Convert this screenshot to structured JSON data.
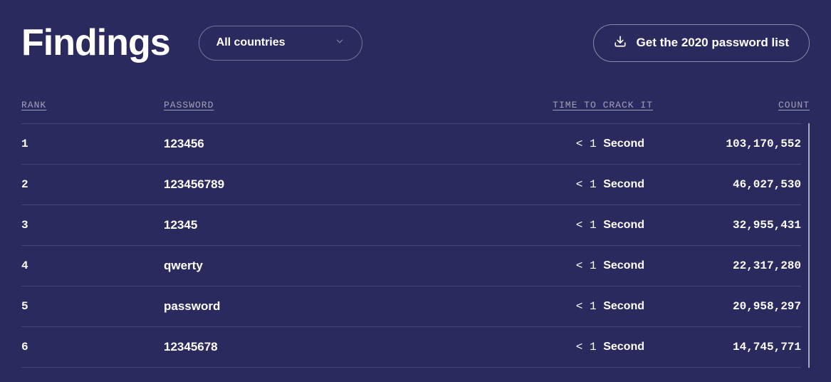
{
  "title": "Findings",
  "dropdown": {
    "selected": "All countries"
  },
  "download_button": "Get the 2020 password list",
  "table": {
    "headers": {
      "rank": "RANK",
      "password": "PASSWORD",
      "time": "TIME TO CRACK IT",
      "count": "COUNT"
    },
    "rows": [
      {
        "rank": "1",
        "password": "123456",
        "time_prefix": "< 1 ",
        "time_unit": "Second",
        "count": "103,170,552"
      },
      {
        "rank": "2",
        "password": "123456789",
        "time_prefix": "< 1 ",
        "time_unit": "Second",
        "count": "46,027,530"
      },
      {
        "rank": "3",
        "password": "12345",
        "time_prefix": "< 1 ",
        "time_unit": "Second",
        "count": "32,955,431"
      },
      {
        "rank": "4",
        "password": "qwerty",
        "time_prefix": "< 1 ",
        "time_unit": "Second",
        "count": "22,317,280"
      },
      {
        "rank": "5",
        "password": "password",
        "time_prefix": "< 1 ",
        "time_unit": "Second",
        "count": "20,958,297"
      },
      {
        "rank": "6",
        "password": "12345678",
        "time_prefix": "< 1 ",
        "time_unit": "Second",
        "count": "14,745,771"
      }
    ]
  }
}
